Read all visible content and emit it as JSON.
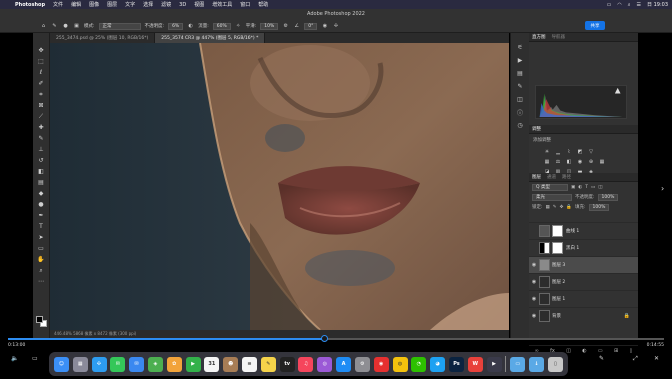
{
  "menubar": {
    "app_name": "Photoshop",
    "items": [
      "文件",
      "编辑",
      "图像",
      "图层",
      "文字",
      "选择",
      "滤镜",
      "3D",
      "视图",
      "增效工具",
      "窗口",
      "帮助"
    ],
    "clock": "日 19:03"
  },
  "options": {
    "window_title": "Adobe Photoshop 2022",
    "mode_label": "模式:",
    "mode_value": "正常",
    "opacity_label": "不透明度:",
    "opacity_value": "6%",
    "flow_label": "流量:",
    "flow_value": "60%",
    "smooth_label": "平滑:",
    "smooth_value": "10%",
    "angle_value": "0°",
    "share_label": "共享"
  },
  "tabs": [
    {
      "label": "255_3474.psd @ 25% (图层 10, RGB/16*)",
      "active": false
    },
    {
      "label": "255_3574 CR3 @ 447% (图层 5, RGB/16*) *",
      "active": true
    }
  ],
  "status": "446.48%   5868 像素 x 8472 像素 (300 ppi)",
  "panels": {
    "histogram_tabs": [
      "直方图",
      "导航器"
    ],
    "adjustments_title": "调整",
    "adjustments_sub": "添加调整",
    "layers_tabs": [
      "图层",
      "通道",
      "路径"
    ],
    "kind_label": "Q 类型",
    "blend_mode": "柔光",
    "opacity_label": "不透明度:",
    "opacity_value": "100%",
    "lock_label": "锁定:",
    "fill_label": "填充:",
    "fill_value": "100%",
    "layers": [
      {
        "name": "曲线 1",
        "selected": false,
        "visible": false
      },
      {
        "name": "黑白 1",
        "selected": false,
        "visible": false
      },
      {
        "name": "图层 3",
        "selected": true,
        "visible": true
      },
      {
        "name": "图层 2",
        "selected": false,
        "visible": true
      },
      {
        "name": "图层 1",
        "selected": false,
        "visible": true
      },
      {
        "name": "背景",
        "selected": false,
        "visible": true
      }
    ]
  },
  "video": {
    "time_elapsed": "0:13:00",
    "time_total": "0:14:55",
    "progress": 0.482
  },
  "dock": {
    "apps": [
      {
        "name": "finder",
        "color": "#3b8ff6",
        "glyph": "☺"
      },
      {
        "name": "launchpad",
        "color": "#8a8a9a",
        "glyph": "▦"
      },
      {
        "name": "safari",
        "color": "#2d9cf0",
        "glyph": "✣"
      },
      {
        "name": "messages",
        "color": "#34c759",
        "glyph": "✉"
      },
      {
        "name": "mail",
        "color": "#3a88f0",
        "glyph": "✉"
      },
      {
        "name": "maps",
        "color": "#4caf50",
        "glyph": "◈"
      },
      {
        "name": "photos",
        "color": "#f2a33a",
        "glyph": "✿"
      },
      {
        "name": "facetime",
        "color": "#32b14a",
        "glyph": "▶"
      },
      {
        "name": "calendar",
        "color": "#f5f5f5",
        "glyph": "31"
      },
      {
        "name": "contacts",
        "color": "#a87d55",
        "glyph": "☻"
      },
      {
        "name": "reminders",
        "color": "#f5f5f5",
        "glyph": "≡"
      },
      {
        "name": "notes",
        "color": "#f5d34a",
        "glyph": "✎"
      },
      {
        "name": "appletv",
        "color": "#222222",
        "glyph": "tv"
      },
      {
        "name": "music",
        "color": "#f5455c",
        "glyph": "♫"
      },
      {
        "name": "podcasts",
        "color": "#9b59d6",
        "glyph": "◎"
      },
      {
        "name": "appstore",
        "color": "#1e8cf5",
        "glyph": "A"
      },
      {
        "name": "settings",
        "color": "#8e8e93",
        "glyph": "⚙"
      },
      {
        "name": "netease-music",
        "color": "#e63030",
        "glyph": "◉"
      },
      {
        "name": "chrome",
        "color": "#f4c20d",
        "glyph": "◍"
      },
      {
        "name": "wechat",
        "color": "#2dc100",
        "glyph": "◔"
      },
      {
        "name": "qq",
        "color": "#1da1f2",
        "glyph": "◕"
      },
      {
        "name": "photoshop",
        "color": "#0b2340",
        "glyph": "Ps"
      },
      {
        "name": "wps",
        "color": "#e8413b",
        "glyph": "W"
      },
      {
        "name": "video-player",
        "color": "#3a3a4a",
        "glyph": "▶"
      },
      {
        "name": "folder",
        "color": "#5aa9e6",
        "glyph": "▭"
      },
      {
        "name": "downloads",
        "color": "#5aa9e6",
        "glyph": "↓"
      },
      {
        "name": "trash",
        "color": "#c8c8c8",
        "glyph": "▯"
      }
    ]
  }
}
